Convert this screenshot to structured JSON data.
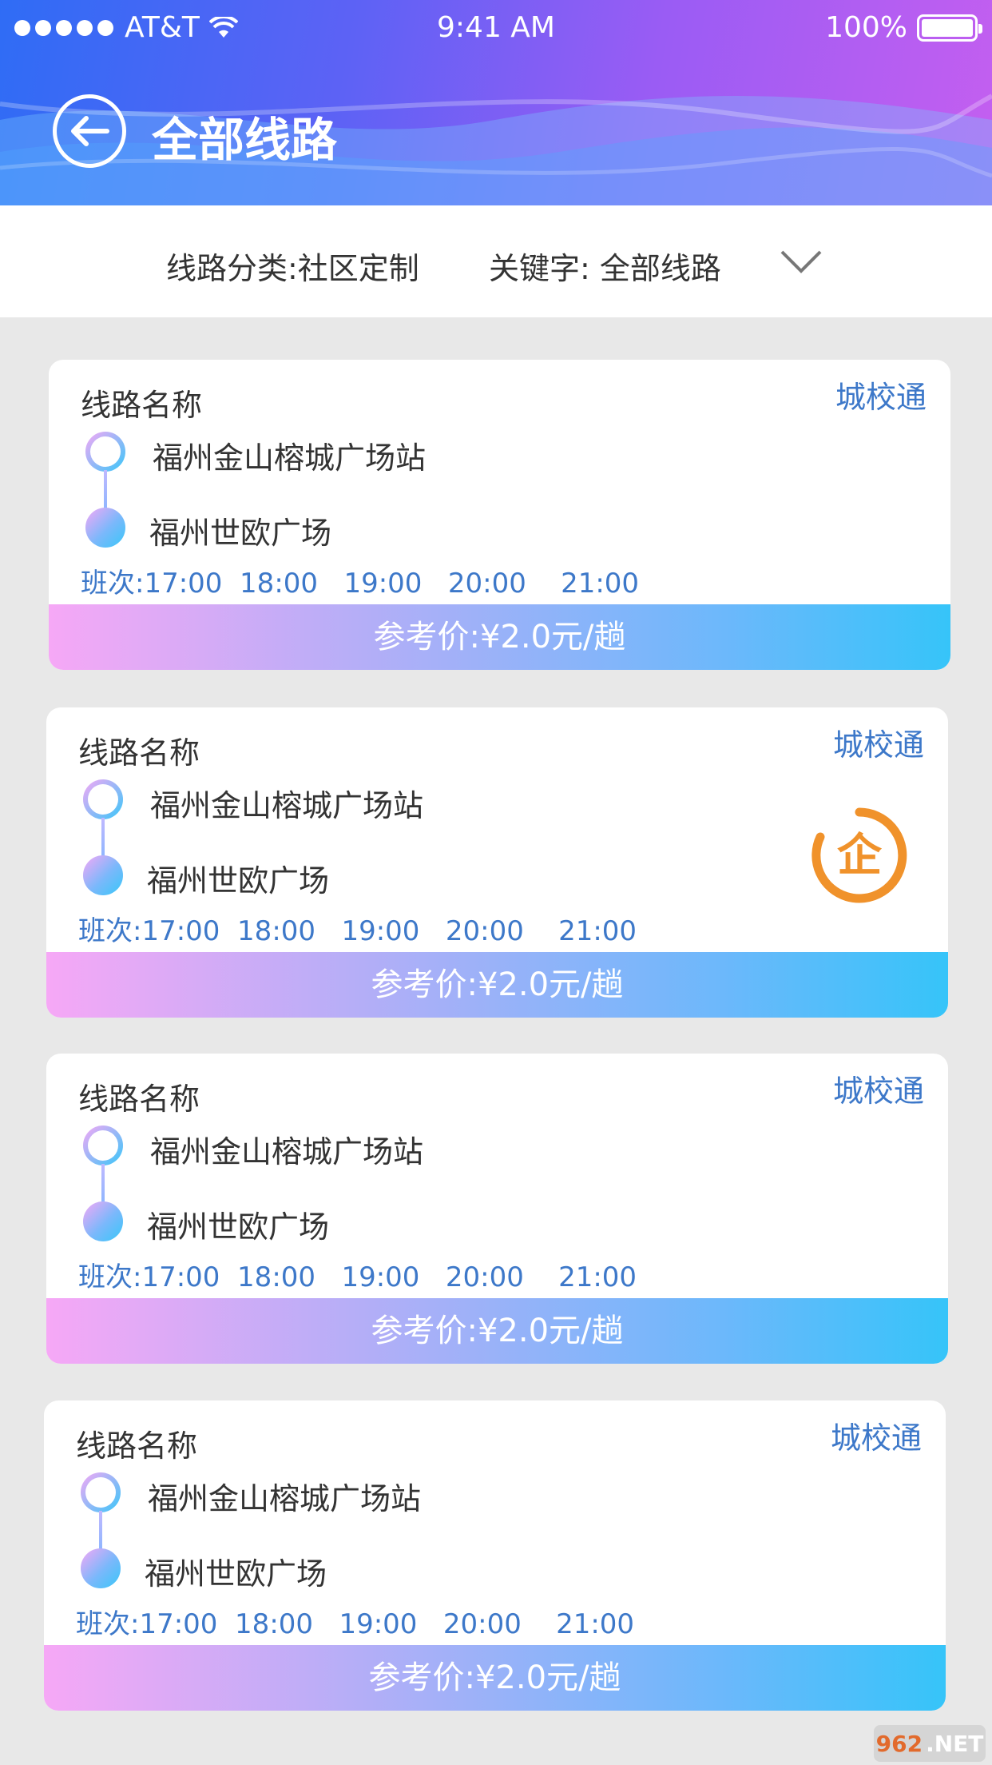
{
  "status_bar": {
    "carrier": "AT&T",
    "time": "9:41 AM",
    "battery": "100%"
  },
  "header": {
    "title": "全部线路",
    "back_icon": "back-arrow-circle-icon"
  },
  "filter": {
    "category": "线路分类:社区定制",
    "keyword": "关键字: 全部线路",
    "dropdown_icon": "chevron-down-icon"
  },
  "cards": [
    {
      "route_name": "线路名称",
      "tag": "城校通",
      "start_stop": "福州金山榕城广场站",
      "end_stop": "福州世欧广场",
      "schedule": "班次:17:00  18:00   19:00   20:00    21:00",
      "price": "参考价:¥2.0元/趟"
    },
    {
      "route_name": "线路名称",
      "tag": "城校通",
      "start_stop": "福州金山榕城广场站",
      "end_stop": "福州世欧广场",
      "schedule": "班次:17:00  18:00   19:00   20:00    21:00",
      "price": "参考价:¥2.0元/趟",
      "badge": "企",
      "badge_color": "#f0922b"
    },
    {
      "route_name": "线路名称",
      "tag": "城校通",
      "start_stop": "福州金山榕城广场站",
      "end_stop": "福州世欧广场",
      "schedule": "班次:17:00  18:00   19:00   20:00    21:00",
      "price": "参考价:¥2.0元/趟"
    },
    {
      "route_name": "线路名称",
      "tag": "城校通",
      "start_stop": "福州金山榕城广场站",
      "end_stop": "福州世欧广场",
      "schedule": "班次:17:00  18:00   19:00   20:00    21:00",
      "price": "参考价:¥2.0元/趟"
    }
  ],
  "watermark": {
    "number": "962",
    "suffix": ".NET"
  }
}
